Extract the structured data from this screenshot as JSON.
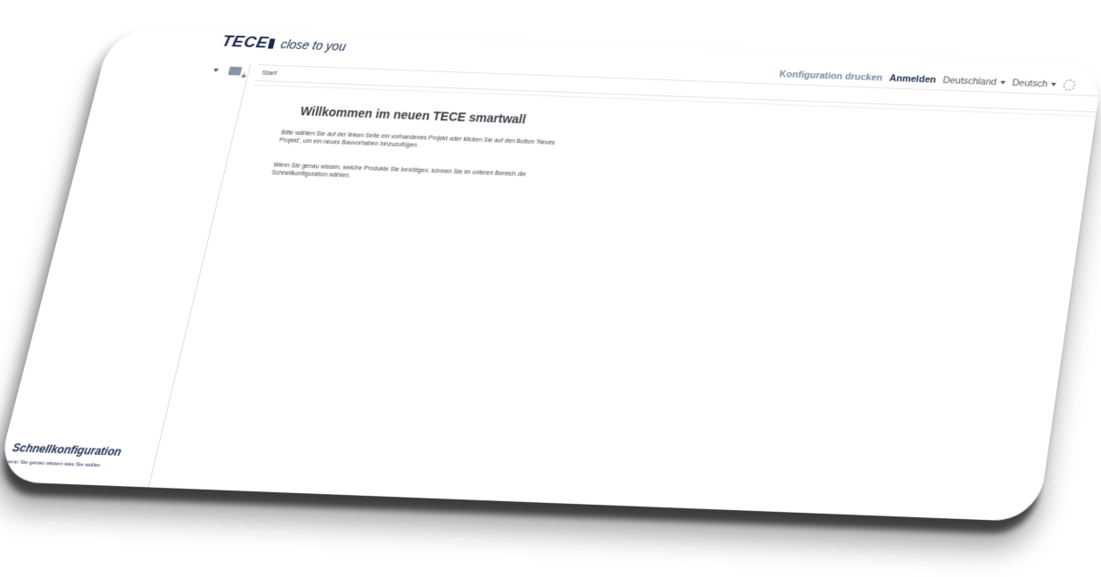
{
  "header": {
    "brand": "TECE",
    "tagline": "close to you",
    "print_config": "Konfiguration drucken",
    "login": "Anmelden",
    "country": "Deutschland",
    "language": "Deutsch"
  },
  "breadcrumb": {
    "current": "Start"
  },
  "welcome": {
    "title": "Willkommen im neuen TECE smartwall",
    "paragraph1": "Bitte wählen Sie auf der linken Seite ein vorhandenes Projekt oder klicken Sie auf den Button 'Neues Projekt', um ein neues Bauvorhaben hinzuzufügen.",
    "paragraph2": "Wenn Sie genau wissen, welche Produkte Sie benötigen, können Sie im unteren Bereich die Schnellkonfiguration wählen."
  },
  "sidebar": {
    "quick_title": "Schnellkonfiguration",
    "quick_subtitle": "wenn Sie genau wissen was Sie wollen"
  },
  "icons": {
    "new_project": "folder-plus-icon",
    "settings": "gear-icon",
    "dropdown": "caret-down-icon"
  },
  "colors": {
    "brand": "#1a2a4e",
    "link_muted": "#7b8aa3"
  }
}
